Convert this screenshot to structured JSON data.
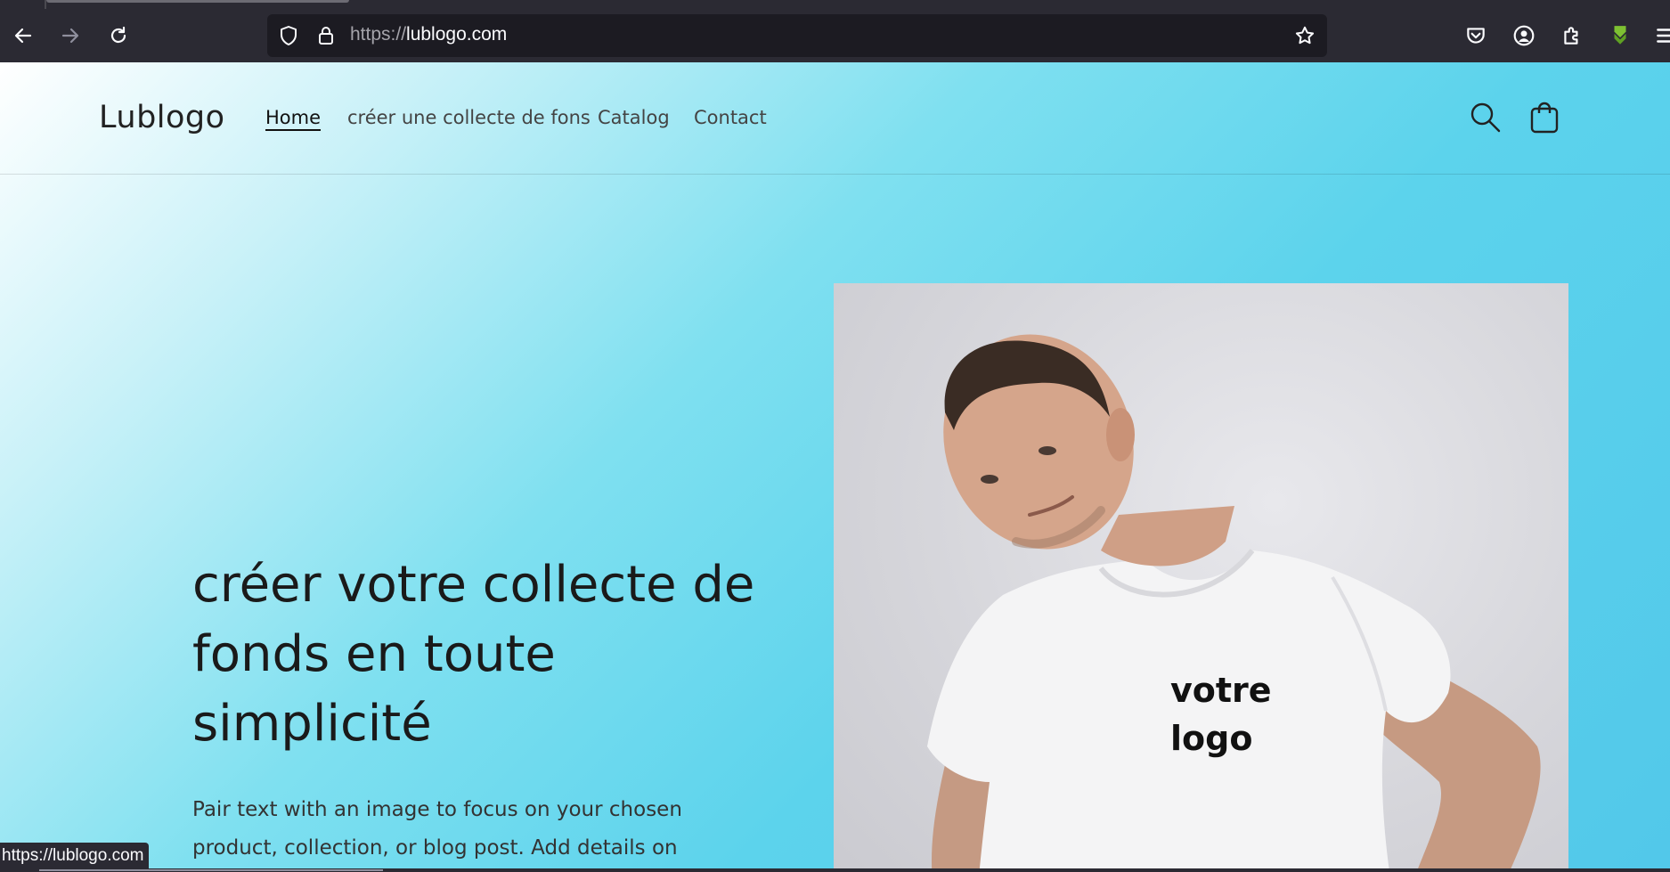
{
  "browser": {
    "url_protocol": "https://",
    "url_host": "lublogo.com",
    "status_url": "https://lublogo.com",
    "icons": {
      "back": "arrow-left-icon",
      "forward": "arrow-right-icon",
      "reload": "reload-icon",
      "shield": "shield-icon",
      "lock": "lock-icon",
      "bookmark": "star-icon",
      "pocket": "pocket-icon",
      "account": "account-icon",
      "extensions": "puzzle-icon",
      "download": "download-icon",
      "menu": "hamburger-menu-icon"
    },
    "colors": {
      "chrome": "#2b2a33",
      "urlbar": "#1c1b22",
      "download_accent": "#7ec132"
    }
  },
  "site": {
    "logo": "Lublogo",
    "nav": [
      {
        "label": "Home",
        "active": true
      },
      {
        "label": "créer une collecte de fons",
        "active": false
      },
      {
        "label": "Catalog",
        "active": false
      },
      {
        "label": "Contact",
        "active": false
      }
    ],
    "icons": {
      "search": "search-icon",
      "cart": "cart-icon"
    }
  },
  "hero": {
    "title": "créer votre collecte de fonds en toute simplicité",
    "text": "Pair text with an image to focus on your chosen product, collection, or blog post. Add details on availability, style,",
    "image_logo_line1": "votre",
    "image_logo_line2": "logo",
    "colors": {
      "gradient_start": "#ffffff",
      "gradient_end": "#52c8ea"
    }
  }
}
